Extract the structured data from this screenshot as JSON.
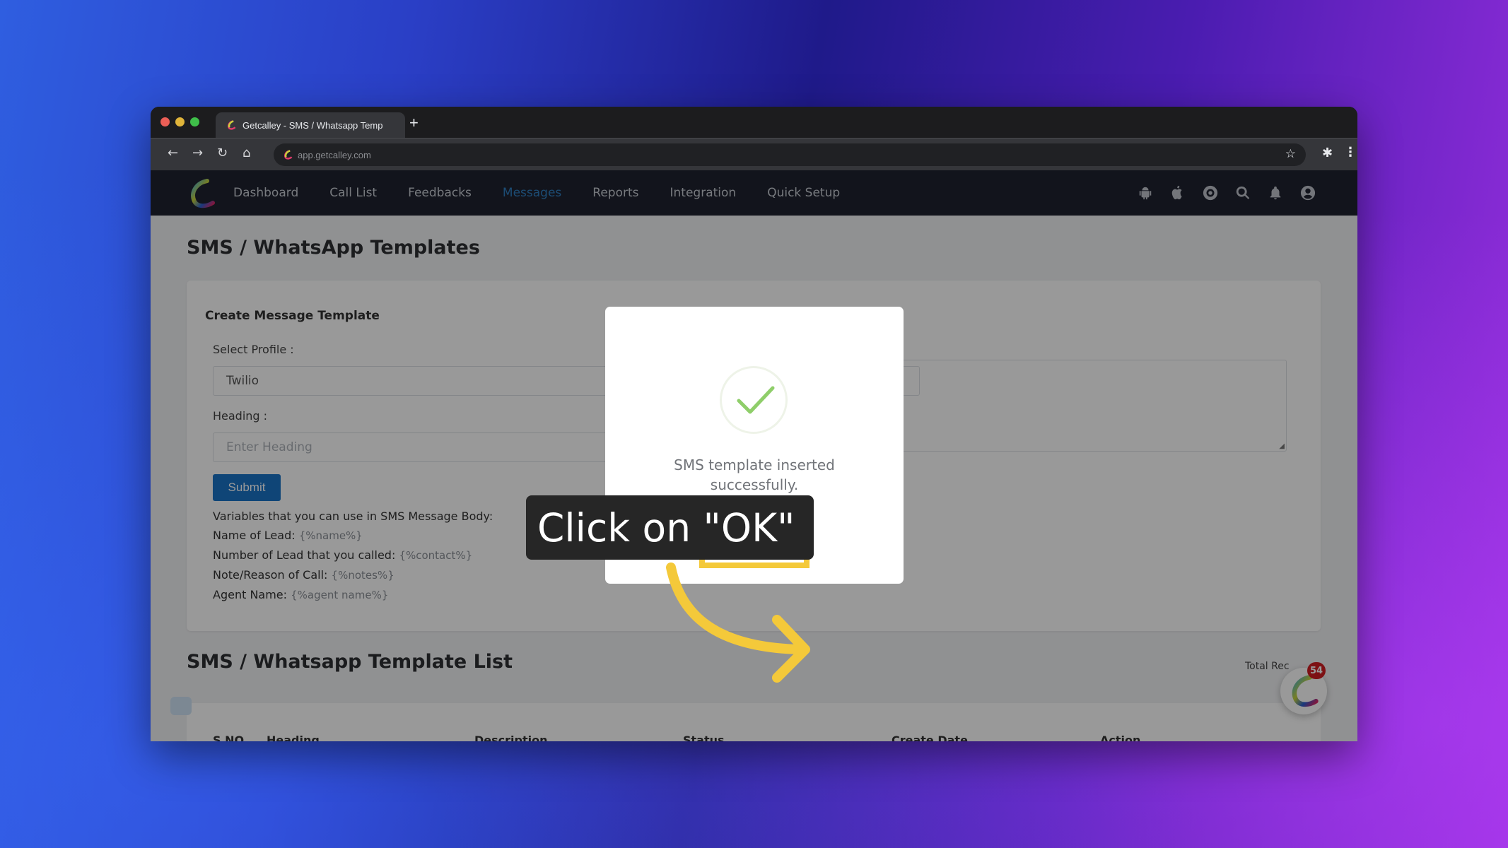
{
  "browser": {
    "tab_title": "Getcalley - SMS / Whatsapp Temp",
    "new_tab_label": "+",
    "url": "app.getcalley.com",
    "nav": {
      "back": "←",
      "forward": "→",
      "reload": "↻",
      "home": "⌂"
    },
    "bookmark_icon": "☆",
    "extensions_icon": "✱",
    "menu_icon": "⋮"
  },
  "appnav": {
    "items": [
      {
        "label": "Dashboard",
        "active": false
      },
      {
        "label": "Call List",
        "active": false
      },
      {
        "label": "Feedbacks",
        "active": false
      },
      {
        "label": "Messages",
        "active": true
      },
      {
        "label": "Reports",
        "active": false
      },
      {
        "label": "Integration",
        "active": false
      },
      {
        "label": "Quick Setup",
        "active": false
      }
    ],
    "icons": [
      "android-icon",
      "apple-icon",
      "support-icon",
      "search-icon",
      "bell-icon",
      "user-icon"
    ],
    "active_color": "#2f7fc1"
  },
  "page": {
    "title": "SMS / WhatsApp Templates",
    "form": {
      "card_title": "Create Message Template",
      "profile_label": "Select Profile :",
      "profile_value": "Twilio",
      "heading_label": "Heading :",
      "heading_placeholder": "Enter Heading",
      "submit_label": "Submit",
      "variables_intro": "Variables that you can use in SMS Message Body:",
      "variables": [
        {
          "label": "Name of Lead:",
          "token": "{%name%}"
        },
        {
          "label": "Number of Lead that you called:",
          "token": "{%contact%}"
        },
        {
          "label": "Note/Reason of Call:",
          "token": "{%notes%}"
        },
        {
          "label": "Agent Name:",
          "token": "{%agent name%}"
        }
      ]
    },
    "list": {
      "title": "SMS / Whatsapp Template List",
      "total_records_label": "Total Rec",
      "columns": [
        "S NO.",
        "Heading",
        "Description",
        "Status",
        "Create Date",
        "Action"
      ]
    },
    "floating_widget": {
      "badge_count": "54"
    }
  },
  "modal": {
    "message": "SMS template inserted successfully.",
    "ok_label": "OK",
    "ok_color": "#1e90d2",
    "highlight_color": "#f4c93a"
  },
  "annotation": {
    "callout_text": "Click on \"OK\""
  }
}
